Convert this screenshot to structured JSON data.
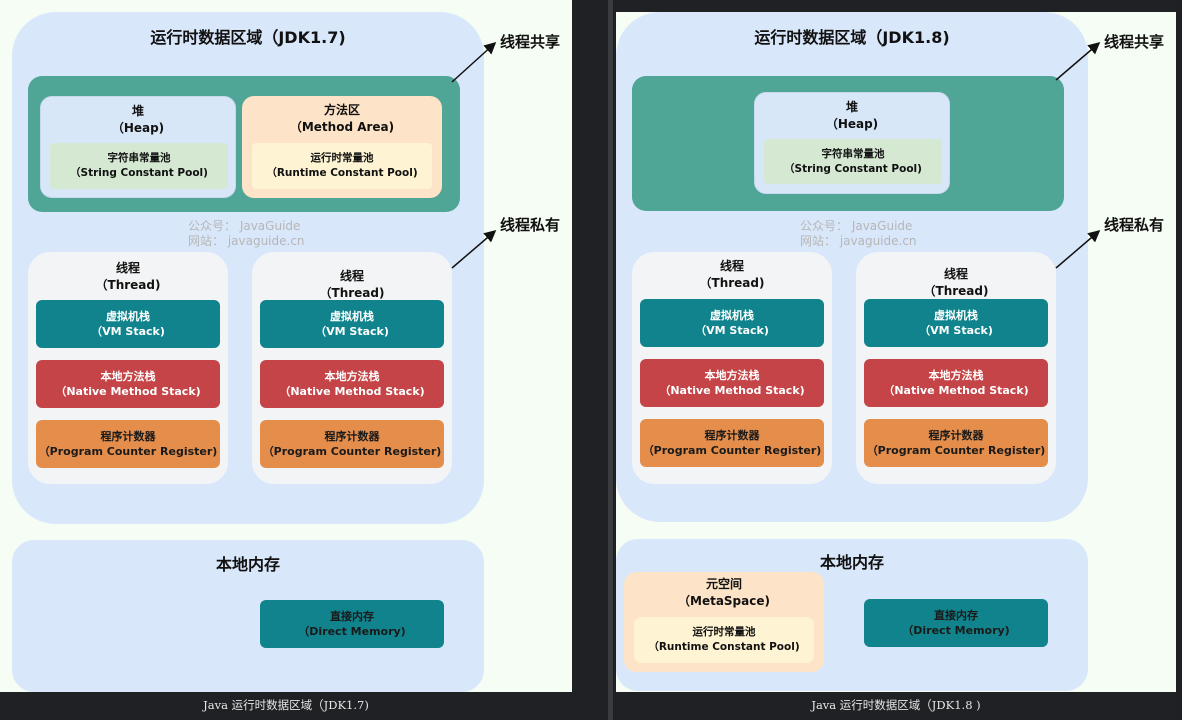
{
  "left": {
    "title": "运行时数据区域（JDK1.7)",
    "heap": {
      "name": "堆",
      "en": "（Heap)",
      "pool_name": "字符串常量池",
      "pool_en": "（String Constant Pool)"
    },
    "method_area": {
      "name": "方法区",
      "en": "（Method Area)",
      "pool_name": "运行时常量池",
      "pool_en": "（Runtime Constant Pool)"
    },
    "threads": [
      {
        "name": "线程",
        "en": "（Thread)",
        "vm": "虚拟机栈",
        "vm_en": "（VM Stack)",
        "native": "本地方法栈",
        "native_en": "（Native Method Stack)",
        "pc": "程序计数器",
        "pc_en": "（Program Counter Register)"
      },
      {
        "name": "线程",
        "en": "（Thread)",
        "vm": "虚拟机栈",
        "vm_en": "（VM Stack)",
        "native": "本地方法栈",
        "native_en": "（Native Method Stack)",
        "pc": "程序计数器",
        "pc_en": "（Program Counter Register)"
      }
    ],
    "native_memory": {
      "title": "本地内存",
      "direct": "直接内存",
      "direct_en": "（Direct Memory)"
    },
    "shared_label": "线程共享",
    "private_label": "线程私有",
    "watermark_1": "公众号：  JavaGuide",
    "watermark_2": "网站：  javaguide.cn",
    "caption": "Java 运行时数据区域（JDK1.7)"
  },
  "right": {
    "title": "运行时数据区域（JDK1.8)",
    "heap": {
      "name": "堆",
      "en": "（Heap)",
      "pool_name": "字符串常量池",
      "pool_en": "（String Constant Pool)"
    },
    "threads": [
      {
        "name": "线程",
        "en": "（Thread)",
        "vm": "虚拟机栈",
        "vm_en": "（VM Stack)",
        "native": "本地方法栈",
        "native_en": "（Native Method Stack)",
        "pc": "程序计数器",
        "pc_en": "（Program Counter Register)"
      },
      {
        "name": "线程",
        "en": "（Thread)",
        "vm": "虚拟机栈",
        "vm_en": "（VM Stack)",
        "native": "本地方法栈",
        "native_en": "（Native Method Stack)",
        "pc": "程序计数器",
        "pc_en": "（Program Counter Register)"
      }
    ],
    "native_memory": {
      "title": "本地内存",
      "meta": "元空间",
      "meta_en": "（MetaSpace)",
      "pool_name": "运行时常量池",
      "pool_en": "（Runtime Constant Pool)",
      "direct": "直接内存",
      "direct_en": "（Direct Memory)"
    },
    "shared_label": "线程共享",
    "private_label": "线程私有",
    "watermark_1": "公众号：  JavaGuide",
    "watermark_2": "网站：  javaguide.cn",
    "caption": "Java 运行时数据区域（JDK1.8 )"
  },
  "colors": {
    "shared": "#4fa596",
    "vm_stack": "#10838c",
    "native_stack": "#c44447",
    "pc": "#e58e4c",
    "runtime_area": "#d9e7fb",
    "panel_bg": "#f6fdf4"
  }
}
